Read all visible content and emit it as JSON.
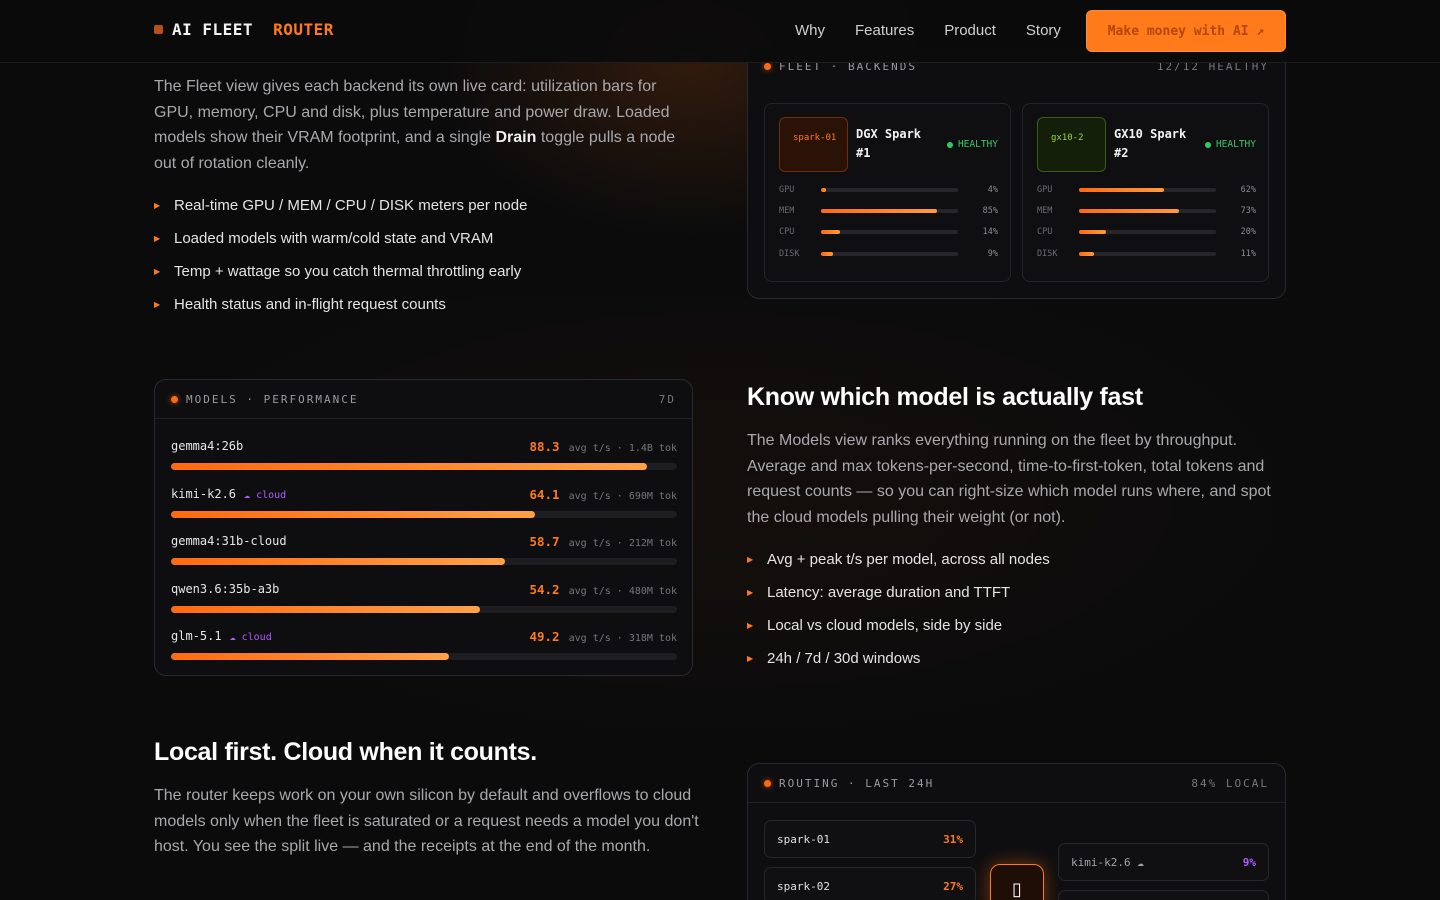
{
  "nav": {
    "brand_a": "AI FLEET",
    "brand_b": "ROUTER",
    "links": [
      "Why",
      "Features",
      "Product",
      "Story"
    ],
    "cta": "Make money with AI ↗"
  },
  "fleet_section": {
    "paragraph_1": "The Fleet view gives each backend its own live card: utilization bars for GPU, memory, CPU and disk, plus temperature and power draw. Loaded models show their VRAM footprint, and a single ",
    "paragraph_bold": "Drain",
    "paragraph_2": " toggle pulls a node out of rotation cleanly.",
    "bullets": [
      "Real-time GPU / MEM / CPU / DISK meters per node",
      "Loaded models with warm/cold state and VRAM",
      "Temp + wattage so you catch thermal throttling early",
      "Health status and in-flight request counts"
    ]
  },
  "fleet_card": {
    "title": "FLEET · BACKENDS",
    "status": "12/12 HEALTHY",
    "nodes": [
      {
        "chip": "spark-01",
        "name": "DGX Spark #1",
        "health": "HEALTHY",
        "meters": [
          {
            "label": "GPU",
            "value": 4,
            "text": "4%"
          },
          {
            "label": "MEM",
            "value": 85,
            "text": "85%"
          },
          {
            "label": "CPU",
            "value": 14,
            "text": "14%"
          },
          {
            "label": "DISK",
            "value": 9,
            "text": "9%"
          }
        ]
      },
      {
        "chip": "gx10-2",
        "name": "GX10 Spark #2",
        "health": "HEALTHY",
        "meters": [
          {
            "label": "GPU",
            "value": 62,
            "text": "62%"
          },
          {
            "label": "MEM",
            "value": 73,
            "text": "73%"
          },
          {
            "label": "CPU",
            "value": 20,
            "text": "20%"
          },
          {
            "label": "DISK",
            "value": 11,
            "text": "11%"
          }
        ]
      }
    ]
  },
  "models_card": {
    "title": "MODELS · PERFORMANCE",
    "window": "7D",
    "stat_unit": "avg t/s ·",
    "max_tps": 100,
    "rows": [
      {
        "name": "gemma4:26b",
        "cloud": "",
        "tps": "88.3",
        "tok": "1.4B tok",
        "fill": 0.94
      },
      {
        "name": "kimi-k2.6",
        "cloud": "☁ cloud",
        "tps": "64.1",
        "tok": "690M tok",
        "fill": 0.72
      },
      {
        "name": "gemma4:31b-cloud",
        "cloud": "",
        "tps": "58.7",
        "tok": "212M tok",
        "fill": 0.66
      },
      {
        "name": "qwen3.6:35b-a3b",
        "cloud": "",
        "tps": "54.2",
        "tok": "480M tok",
        "fill": 0.61
      },
      {
        "name": "glm-5.1",
        "cloud": "☁ cloud",
        "tps": "49.2",
        "tok": "318M tok",
        "fill": 0.55
      }
    ]
  },
  "models_section": {
    "heading": "Know which model is actually fast",
    "paragraph": "The Models view ranks everything running on the fleet by throughput. Average and max tokens-per-second, time-to-first-token, total tokens and request counts — so you can right-size which model runs where, and spot the cloud models pulling their weight (or not).",
    "bullets": [
      "Avg + peak t/s per model, across all nodes",
      "Latency: average duration and TTFT",
      "Local vs cloud models, side by side",
      "24h / 7d / 30d windows"
    ]
  },
  "routing_section": {
    "heading": "Local first. Cloud when it counts.",
    "paragraph": "The router keeps work on your own silicon by default and overflows to cloud models only when the fleet is saturated or a request needs a model you don't host. You see the split live — and the receipts at the end of the month."
  },
  "routing_card": {
    "title": "ROUTING · LAST 24H",
    "status": "84% LOCAL",
    "local": [
      {
        "name": "spark-01",
        "pct": "31%"
      },
      {
        "name": "spark-02",
        "pct": "27%"
      }
    ],
    "cloud": [
      {
        "name": "kimi-k2.6 ☁",
        "pct": "9%"
      }
    ],
    "hub_icon": "router-icon"
  },
  "colors": {
    "accent": "#ff7a1a",
    "healthy": "#2ecc64",
    "cloud": "#b05cff",
    "background": "#0b0b0c"
  }
}
